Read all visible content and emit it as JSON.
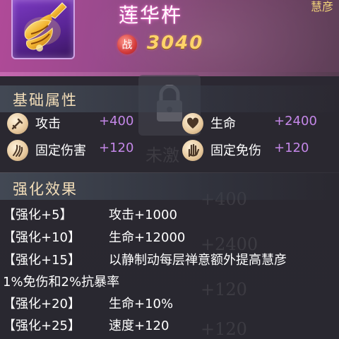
{
  "header": {
    "item_name": "莲华杵",
    "tag": "慧彦",
    "power_glyph": "战",
    "power_value": "3040",
    "item_icon": "golden-vajra-icon"
  },
  "background": {
    "locked_text": "未激",
    "ghost_values": [
      "+400",
      "+2400",
      "+120",
      "+120"
    ]
  },
  "base_attrs": {
    "title": "基础属性",
    "items": [
      {
        "icon": "sword-icon",
        "name": "攻击",
        "value": "+400"
      },
      {
        "icon": "heart-icon",
        "name": "生命",
        "value": "+2400"
      },
      {
        "icon": "claw-icon",
        "name": "固定伤害",
        "value": "+120"
      },
      {
        "icon": "palm-icon",
        "name": "固定免伤",
        "value": "+120"
      }
    ]
  },
  "enhance": {
    "title": "强化效果",
    "items": [
      {
        "level": "【强化+5】",
        "effect": "攻击+1000"
      },
      {
        "level": "【强化+10】",
        "effect": "生命+12000"
      },
      {
        "level": "【强化+15】",
        "effect": "以静制动每层禅意额外提高慧彦"
      },
      {
        "level": "",
        "effect": "1%免伤和2%抗暴率"
      },
      {
        "level": "【强化+20】",
        "effect": "生命+10%"
      },
      {
        "level": "【强化+25】",
        "effect": "速度+120"
      }
    ]
  },
  "colors": {
    "header_purple": "#9a4a8d",
    "power_gold": "#ffd36a",
    "attr_value": "#c487e8",
    "section_title": "#f3deb9"
  }
}
